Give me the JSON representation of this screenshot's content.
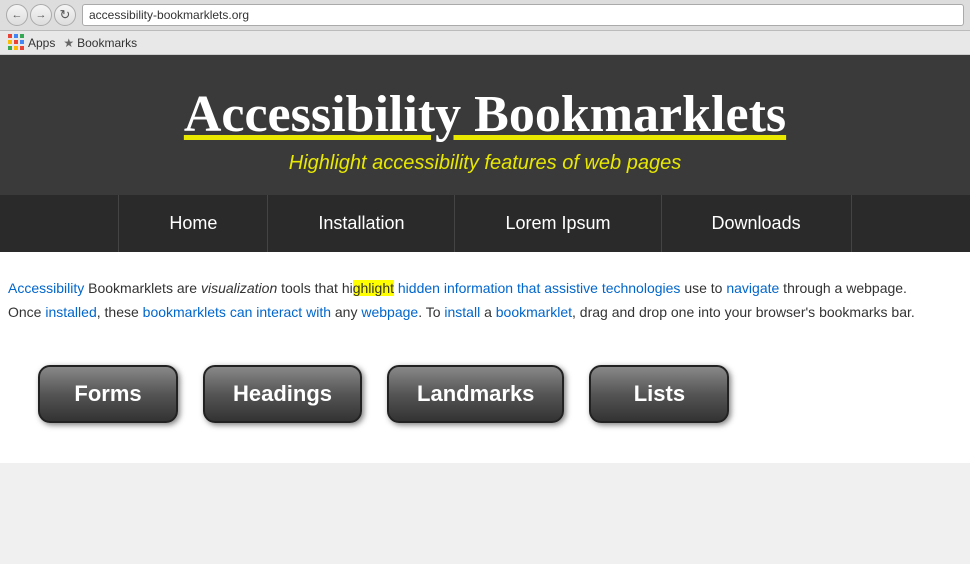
{
  "browser": {
    "back_title": "Back",
    "forward_title": "Forward",
    "reload_title": "Reload",
    "address": "accessibility-bookmarklets.org",
    "apps_label": "Apps",
    "bookmarks_label": "Bookmarks"
  },
  "site": {
    "title": "Accessibility Bookmarklets",
    "subtitle": "Highlight accessibility features of web pages",
    "nav": {
      "items": [
        {
          "label": "Home"
        },
        {
          "label": "Installation"
        },
        {
          "label": "Lorem Ipsum"
        },
        {
          "label": "Downloads"
        }
      ]
    },
    "intro": {
      "line1": "Accessibility Bookmarklets are visualization tools that highlight hidden information that assistive technologies use to navigate through a webpage.",
      "line2": "Once installed, these bookmarklets can interact with any webpage. To install a bookmarklet, drag and drop one into your browser's bookmarks bar."
    },
    "buttons": [
      {
        "label": "Forms"
      },
      {
        "label": "Headings"
      },
      {
        "label": "Landmarks"
      },
      {
        "label": "Lists"
      }
    ]
  }
}
